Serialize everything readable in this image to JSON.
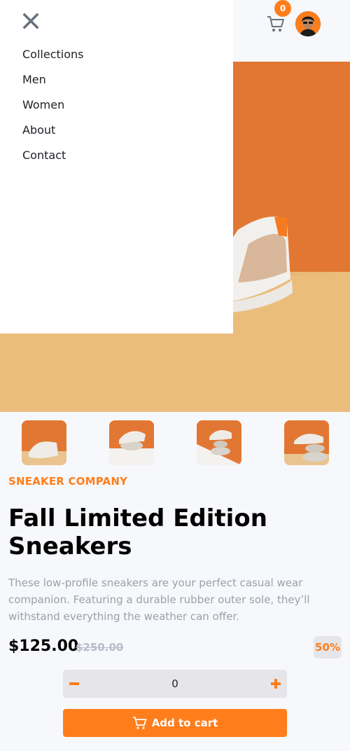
{
  "header": {
    "cart_count": "0"
  },
  "menu": {
    "items": [
      "Collections",
      "Men",
      "Women",
      "About",
      "Contact"
    ]
  },
  "product": {
    "company": "SNEAKER COMPANY",
    "title": "Fall Limited Edition Sneakers",
    "description": "These low-profile sneakers are your perfect casual wear companion. Featuring a durable rubber outer sole, they’ll withstand everything the weather can offer.",
    "price": "$125.00",
    "old_price": "$250.00",
    "discount": "50%"
  },
  "quantity": {
    "value": "0"
  },
  "add_to_cart": {
    "label": "Add to cart"
  },
  "colors": {
    "accent": "#ff7e1b",
    "hero_bg": "#e27734",
    "floor": "#e9b877"
  }
}
